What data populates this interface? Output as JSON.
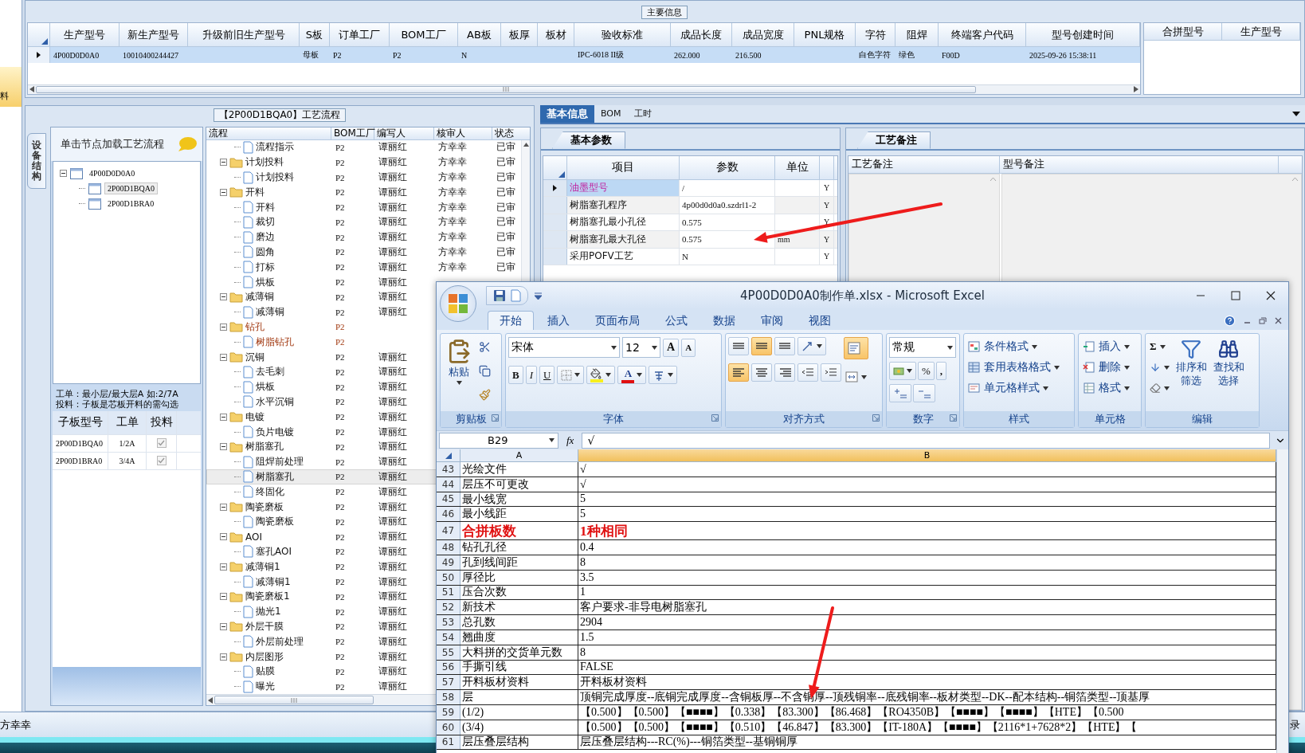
{
  "side_strip": {
    "items": [
      {
        "label": "料",
        "selected": true
      }
    ]
  },
  "main_info": {
    "title": "主要信息",
    "columns": [
      "生产型号",
      "新生产型号",
      "升级前旧生产型号",
      "S板",
      "订单工厂",
      "BOM工厂",
      "AB板",
      "板厚",
      "板材",
      "验收标准",
      "成品长度",
      "成品宽度",
      "PNL规格",
      "字符",
      "阻焊",
      "终端客户代码",
      "型号创建时间"
    ],
    "rows": [
      {
        "selected": true,
        "cells": [
          "4P00D0D0A0",
          "10010400244427",
          null,
          "母板",
          "P2",
          "P2",
          "N",
          null,
          null,
          "IPC-6018 II级",
          "262.000",
          "216.500",
          null,
          "白色字符",
          "绿色",
          "F00D",
          "2025-09-26 15:38:11"
        ]
      }
    ],
    "side_columns": [
      "合拼型号",
      "生产型号"
    ]
  },
  "process": {
    "title": "【2P00D1BQA0】工艺流程",
    "side_tab": "设备结构",
    "hint": "单击节点加载工艺流程",
    "structure": [
      {
        "label": "4P00D0D0A0",
        "expanded": true,
        "selected": false,
        "children": [
          {
            "label": "2P00D1BQA0",
            "selected": true
          },
          {
            "label": "2P00D1BRA0",
            "selected": false
          }
        ]
      }
    ],
    "notes": [
      "工单：最小层/最大层A 如:2/7A",
      "投料：子板是芯板开料的需勾选"
    ],
    "boards": {
      "columns": [
        "子板型号",
        "工单",
        "投料"
      ],
      "rows": [
        {
          "board": "2P00D1BQA0",
          "order": "1/2A",
          "feed": true
        },
        {
          "board": "2P00D1BRA0",
          "order": "3/4A",
          "feed": true
        }
      ]
    },
    "flow": {
      "columns": [
        "流程",
        "BOM工厂",
        "编写人",
        "核审人",
        "状态"
      ],
      "rows": [
        {
          "kind": "file",
          "label": "流程指示",
          "bom": "P2",
          "writer": "谭丽红",
          "reviewer": "方幸幸",
          "status": "已审",
          "flagged": false,
          "selected": false
        },
        {
          "kind": "folder",
          "label": "计划投料",
          "bom": "P2",
          "writer": "谭丽红",
          "reviewer": "方幸幸",
          "status": "已审",
          "expanded": true,
          "flagged": false,
          "selected": false,
          "children": [
            {
              "kind": "file",
              "label": "计划投料",
              "bom": "P2",
              "writer": "谭丽红",
              "reviewer": "方幸幸",
              "status": "已审",
              "flagged": false,
              "selected": false
            }
          ]
        },
        {
          "kind": "folder",
          "label": "开料",
          "bom": "P2",
          "writer": "谭丽红",
          "reviewer": "方幸幸",
          "status": "已审",
          "expanded": true,
          "flagged": false,
          "selected": false,
          "children": [
            {
              "kind": "file",
              "label": "开料",
              "bom": "P2",
              "writer": "谭丽红",
              "reviewer": "方幸幸",
              "status": "已审",
              "flagged": false,
              "selected": false
            },
            {
              "kind": "file",
              "label": "裁切",
              "bom": "P2",
              "writer": "谭丽红",
              "reviewer": "方幸幸",
              "status": "已审",
              "flagged": false,
              "selected": false
            },
            {
              "kind": "file",
              "label": "磨边",
              "bom": "P2",
              "writer": "谭丽红",
              "reviewer": "方幸幸",
              "status": "已审",
              "flagged": false,
              "selected": false
            },
            {
              "kind": "file",
              "label": "圆角",
              "bom": "P2",
              "writer": "谭丽红",
              "reviewer": "方幸幸",
              "status": "已审",
              "flagged": false,
              "selected": false
            },
            {
              "kind": "file",
              "label": "打标",
              "bom": "P2",
              "writer": "谭丽红",
              "reviewer": "方幸幸",
              "status": "已审",
              "flagged": false,
              "selected": false
            },
            {
              "kind": "file",
              "label": "烘板",
              "bom": "P2",
              "writer": "谭丽红",
              "flagged": false,
              "selected": false
            }
          ]
        },
        {
          "kind": "folder",
          "label": "减薄铜",
          "bom": "P2",
          "writer": "谭丽红",
          "expanded": true,
          "flagged": false,
          "selected": false,
          "children": [
            {
              "kind": "file",
              "label": "减薄铜",
              "bom": "P2",
              "writer": "谭丽红",
              "flagged": false,
              "selected": false
            }
          ]
        },
        {
          "kind": "folder",
          "label": "钻孔",
          "bom": "P2",
          "expanded": true,
          "flagged": true,
          "selected": false,
          "children": [
            {
              "kind": "file",
              "label": "树脂钻孔",
              "bom": "P2",
              "flagged": true,
              "selected": false
            }
          ]
        },
        {
          "kind": "folder",
          "label": "沉铜",
          "bom": "P2",
          "writer": "谭丽红",
          "expanded": true,
          "flagged": false,
          "selected": false,
          "children": [
            {
              "kind": "file",
              "label": "去毛刺",
              "bom": "P2",
              "writer": "谭丽红",
              "flagged": false,
              "selected": false
            },
            {
              "kind": "file",
              "label": "烘板",
              "bom": "P2",
              "writer": "谭丽红",
              "flagged": false,
              "selected": false
            },
            {
              "kind": "file",
              "label": "水平沉铜",
              "bom": "P2",
              "writer": "谭丽红",
              "flagged": false,
              "selected": false
            }
          ]
        },
        {
          "kind": "folder",
          "label": "电镀",
          "bom": "P2",
          "writer": "谭丽红",
          "expanded": true,
          "flagged": false,
          "selected": false,
          "children": [
            {
              "kind": "file",
              "label": "负片电镀",
              "bom": "P2",
              "writer": "谭丽红",
              "flagged": false,
              "selected": false
            }
          ]
        },
        {
          "kind": "folder",
          "label": "树脂塞孔",
          "bom": "P2",
          "writer": "谭丽红",
          "expanded": true,
          "flagged": false,
          "selected": false,
          "children": [
            {
              "kind": "file",
              "label": "阻焊前处理",
              "bom": "P2",
              "writer": "谭丽红",
              "flagged": false,
              "selected": false
            },
            {
              "kind": "file",
              "label": "树脂塞孔",
              "bom": "P2",
              "writer": "谭丽红",
              "flagged": false,
              "selected": true
            },
            {
              "kind": "file",
              "label": "终固化",
              "bom": "P2",
              "writer": "谭丽红",
              "flagged": false,
              "selected": false
            }
          ]
        },
        {
          "kind": "folder",
          "label": "陶瓷磨板",
          "bom": "P2",
          "writer": "谭丽红",
          "expanded": true,
          "flagged": false,
          "selected": false,
          "children": [
            {
              "kind": "file",
              "label": "陶瓷磨板",
              "bom": "P2",
              "writer": "谭丽红",
              "flagged": false,
              "selected": false
            }
          ]
        },
        {
          "kind": "folder",
          "label": "AOI",
          "bom": "P2",
          "writer": "谭丽红",
          "expanded": true,
          "flagged": false,
          "selected": false,
          "children": [
            {
              "kind": "file",
              "label": "塞孔AOI",
              "bom": "P2",
              "writer": "谭丽红",
              "flagged": false,
              "selected": false
            }
          ]
        },
        {
          "kind": "folder",
          "label": "减薄铜1",
          "bom": "P2",
          "writer": "谭丽红",
          "expanded": true,
          "flagged": false,
          "selected": false,
          "children": [
            {
              "kind": "file",
              "label": "减薄铜1",
              "bom": "P2",
              "writer": "谭丽红",
              "flagged": false,
              "selected": false
            }
          ]
        },
        {
          "kind": "folder",
          "label": "陶瓷磨板1",
          "bom": "P2",
          "writer": "谭丽红",
          "expanded": true,
          "flagged": false,
          "selected": false,
          "children": [
            {
              "kind": "file",
              "label": "抛光1",
              "bom": "P2",
              "writer": "谭丽红",
              "flagged": false,
              "selected": false
            }
          ]
        },
        {
          "kind": "folder",
          "label": "外层干膜",
          "bom": "P2",
          "writer": "谭丽红",
          "expanded": true,
          "flagged": false,
          "selected": false,
          "children": [
            {
              "kind": "file",
              "label": "外层前处理",
              "bom": "P2",
              "writer": "谭丽红",
              "flagged": false,
              "selected": false
            }
          ]
        },
        {
          "kind": "folder",
          "label": "内层图形",
          "bom": "P2",
          "writer": "谭丽红",
          "expanded": true,
          "flagged": false,
          "selected": false,
          "children": [
            {
              "kind": "file",
              "label": "贴膜",
              "bom": "P2",
              "writer": "谭丽红",
              "flagged": false,
              "selected": false
            },
            {
              "kind": "file",
              "label": "曝光",
              "bom": "P2",
              "writer": "谭丽红",
              "flagged": false,
              "selected": false
            }
          ]
        }
      ]
    }
  },
  "details": {
    "tabs": [
      {
        "label": "基本信息",
        "selected": true
      },
      {
        "label": "BOM",
        "selected": false
      },
      {
        "label": "工时",
        "selected": false
      }
    ],
    "params": {
      "tab": "基本参数",
      "columns": [
        "项目",
        "参数",
        "单位"
      ],
      "rows": [
        {
          "item": "油墨型号",
          "value": "/",
          "flag": "Y",
          "selected": true
        },
        {
          "item": "树脂塞孔程序",
          "value": "4p00d0d0a0.szdrl1-2",
          "flag": "Y",
          "selected": false
        },
        {
          "item": "树脂塞孔最小孔径",
          "value": "0.575",
          "flag": "Y",
          "selected": false
        },
        {
          "item": "树脂塞孔最大孔径",
          "value": "0.575",
          "unit": "mm",
          "flag": "Y",
          "selected": false
        },
        {
          "item": "采用POFV工艺",
          "value": "N",
          "flag": "Y",
          "selected": false
        }
      ]
    },
    "remarks": {
      "tab": "工艺备注",
      "columns": [
        "工艺备注",
        "型号备注"
      ]
    }
  },
  "excel": {
    "title": "4P00D0D0A0制作单.xlsx - Microsoft Excel",
    "tabs": [
      {
        "label": "开始",
        "selected": true
      },
      {
        "label": "插入",
        "selected": false
      },
      {
        "label": "页面布局",
        "selected": false
      },
      {
        "label": "公式",
        "selected": false
      },
      {
        "label": "数据",
        "selected": false
      },
      {
        "label": "审阅",
        "selected": false
      },
      {
        "label": "视图",
        "selected": false
      }
    ],
    "ribbon": {
      "clipboard": {
        "label": "剪贴板",
        "paste": "粘贴"
      },
      "font": {
        "label": "字体",
        "face": "宋体",
        "size": "12",
        "grow": "A",
        "shrink": "A",
        "bold": "B",
        "italic": "I",
        "underline": "U",
        "color_key": "A"
      },
      "alignment": {
        "label": "对齐方式",
        "vertical": [
          {
            "selected": false
          },
          {
            "selected": true
          },
          {
            "selected": false
          }
        ],
        "horizontal": [
          {
            "selected": true
          },
          {
            "selected": false
          },
          {
            "selected": false
          }
        ],
        "wrap": {
          "selected": true
        }
      },
      "number": {
        "label": "数字",
        "format": "常规",
        "percent": "%",
        "comma": ","
      },
      "styles": {
        "label": "样式",
        "items": [
          "条件格式",
          "套用表格格式",
          "单元格样式"
        ]
      },
      "cells": {
        "label": "单元格",
        "items": [
          "插入",
          "删除",
          "格式"
        ]
      },
      "editing": {
        "label": "编辑",
        "sum": "Σ",
        "sort": "排序和筛选",
        "find": "查找和选择"
      }
    },
    "name_box": "B29",
    "fx": "fx",
    "formula": "√",
    "columns": [
      {
        "label": "A",
        "selected": false
      },
      {
        "label": "B",
        "selected": true
      }
    ],
    "rows": [
      {
        "num": "43",
        "a": "光绘文件",
        "b": "√",
        "emphasis": false
      },
      {
        "num": "44",
        "a": "层压不可更改",
        "b": "√",
        "emphasis": false
      },
      {
        "num": "45",
        "a": "最小线宽",
        "b": "5",
        "emphasis": false
      },
      {
        "num": "46",
        "a": "最小线距",
        "b": "5",
        "emphasis": false
      },
      {
        "num": "47",
        "a": "合拼板数",
        "b": "1种相同",
        "emphasis": true
      },
      {
        "num": "48",
        "a": "钻孔孔径",
        "b": "0.4",
        "emphasis": false
      },
      {
        "num": "49",
        "a": "孔到线间距",
        "b": "8",
        "emphasis": false
      },
      {
        "num": "50",
        "a": "厚径比",
        "b": "3.5",
        "emphasis": false
      },
      {
        "num": "51",
        "a": "压合次数",
        "b": "1",
        "emphasis": false
      },
      {
        "num": "52",
        "a": "新技术",
        "b": "客户要求-非导电树脂塞孔",
        "emphasis": false
      },
      {
        "num": "53",
        "a": "总孔数",
        "b": "2904",
        "emphasis": false
      },
      {
        "num": "54",
        "a": "翘曲度",
        "b": "1.5",
        "emphasis": false
      },
      {
        "num": "55",
        "a": "大料拼的交货单元数",
        "b": "8",
        "emphasis": false
      },
      {
        "num": "56",
        "a": "手撕引线",
        "b": "FALSE",
        "emphasis": false
      },
      {
        "num": "57",
        "a": "开料板材资料",
        "b": "开料板材资料",
        "emphasis": false
      },
      {
        "num": "58",
        "a": "层",
        "b": "顶铜完成厚度--底铜完成厚度--含铜板厚--不含铜厚--顶残铜率--底残铜率--板材类型--DK--配本结构--铜箔类型--顶基厚",
        "emphasis": false
      },
      {
        "num": "59",
        "a": "(1/2)",
        "b": "【0.500】【0.500】【■■■■】【0.338】【83.300】【86.468】【RO4350B】【■■■■】【■■■■】【HTE】【0.500",
        "emphasis": false
      },
      {
        "num": "60",
        "a": "(3/4)",
        "b": "【0.500】【0.500】【■■■■】【0.510】【46.847】【83.300】【IT-180A】【■■■■】【2116*1+7628*2】【HTE】【",
        "emphasis": false
      },
      {
        "num": "61",
        "a": "层压叠层结构",
        "b": "层压叠层结构---RC(%)---铜箔类型--基铜铜厚",
        "emphasis": false
      }
    ]
  },
  "status_bar": {
    "user": "方幸幸",
    "right": "录"
  },
  "annotations": [
    {
      "kind": "arrow"
    },
    {
      "kind": "arrow"
    }
  ]
}
